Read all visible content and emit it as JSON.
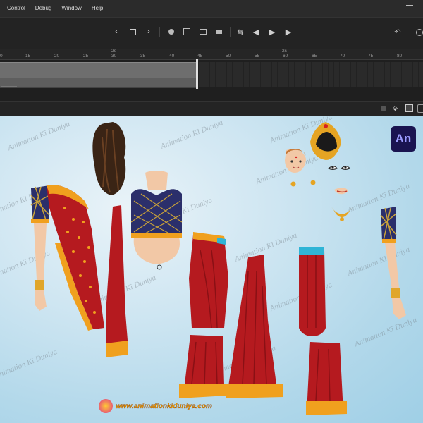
{
  "menu": [
    "Control",
    "Debug",
    "Window",
    "Help"
  ],
  "timeline": {
    "ruler_ticks": [
      "0",
      "15",
      "20",
      "25",
      "30",
      "35",
      "40",
      "45",
      "50",
      "55",
      "60",
      "65",
      "70",
      "75",
      "80"
    ],
    "markers": [
      "2s",
      "2s"
    ]
  },
  "stage": {
    "watermark": "Animation Ki Duniya",
    "badge": "An",
    "brand_url": "www.animationkiduniya.com"
  },
  "colors": {
    "saree_red": "#b51a1f",
    "border_orange": "#f0a01e",
    "blouse_navy": "#2b2f6b",
    "skin": "#f2c8a6"
  },
  "icons": [
    "prev-frame-icon",
    "loop-icon",
    "onion-skin-icon",
    "next-frame-icon",
    "play-icon",
    "stop-icon",
    "step-back-icon",
    "step-forward-icon",
    "undo-icon"
  ]
}
